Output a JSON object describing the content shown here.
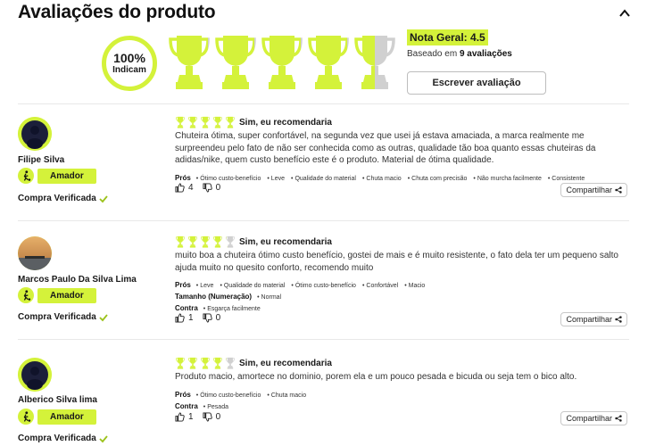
{
  "header": {
    "title": "Avaliações do produto"
  },
  "summary": {
    "recommend_pct": "100%",
    "recommend_label": "Indicam",
    "overall_label": "Nota Geral: 4.5",
    "overall_score": 4.5,
    "based_prefix": "Baseado em ",
    "based_count": "9 avaliações",
    "write_button": "Escrever avaliação"
  },
  "reviews": [
    {
      "author": "Filipe Silva",
      "rank": "Amador",
      "verified": "Compra Verificada",
      "rating": 5,
      "recommend": "Sim, eu recomendaria",
      "text": "Chuteira ótima, super confortável, na segunda vez que usei já estava amaciada, a marca realmente me surpreendeu pelo fato de não ser conhecida como as outras, qualidade tão boa quanto essas chuteiras da adidas/nike, quem custo benefício este é o produto. Material de ótima qualidade.",
      "pros_label": "Prós",
      "pros": [
        "Ótimo custo-benefício",
        "Leve",
        "Qualidade do material",
        "Chuta macio",
        "Chuta com precisão",
        "Não murcha facilmente",
        "Consistente"
      ],
      "likes": "4",
      "dislikes": "0",
      "share": "Compartilhar"
    },
    {
      "author": "Marcos Paulo Da Silva Lima",
      "rank": "Amador",
      "verified": "Compra Verificada",
      "rating": 4,
      "recommend": "Sim, eu recomendaria",
      "text": "muito boa a chuteira ótimo custo benefício, gostei de mais e é muito resistente, o fato dela ter um pequeno salto ajuda muito no quesito conforto, recomendo muito",
      "pros_label": "Prós",
      "pros": [
        "Leve",
        "Qualidade do material",
        "Ótimo custo-benefício",
        "Confortável",
        "Macio"
      ],
      "size_label": "Tamanho (Numeração)",
      "size_value": "Normal",
      "cons_label": "Contra",
      "cons": [
        "Esgarça facilmente"
      ],
      "likes": "1",
      "dislikes": "0",
      "share": "Compartilhar"
    },
    {
      "author": "Alberico Silva lima",
      "rank": "Amador",
      "verified": "Compra Verificada",
      "rating": 4,
      "recommend": "Sim, eu recomendaria",
      "text": "Produto macio, amortece no dominio, porem ela e um pouco pesada e bicuda ou seja tem o bico alto.",
      "pros_label": "Prós",
      "pros": [
        "Ótimo custo-benefício",
        "Chuta macio"
      ],
      "cons_label": "Contra",
      "cons": [
        "Pesada"
      ],
      "likes": "1",
      "dislikes": "0",
      "share": "Compartilhar"
    }
  ],
  "colors": {
    "accent": "#d4f23a",
    "trophy_empty": "#d0d0d0"
  }
}
